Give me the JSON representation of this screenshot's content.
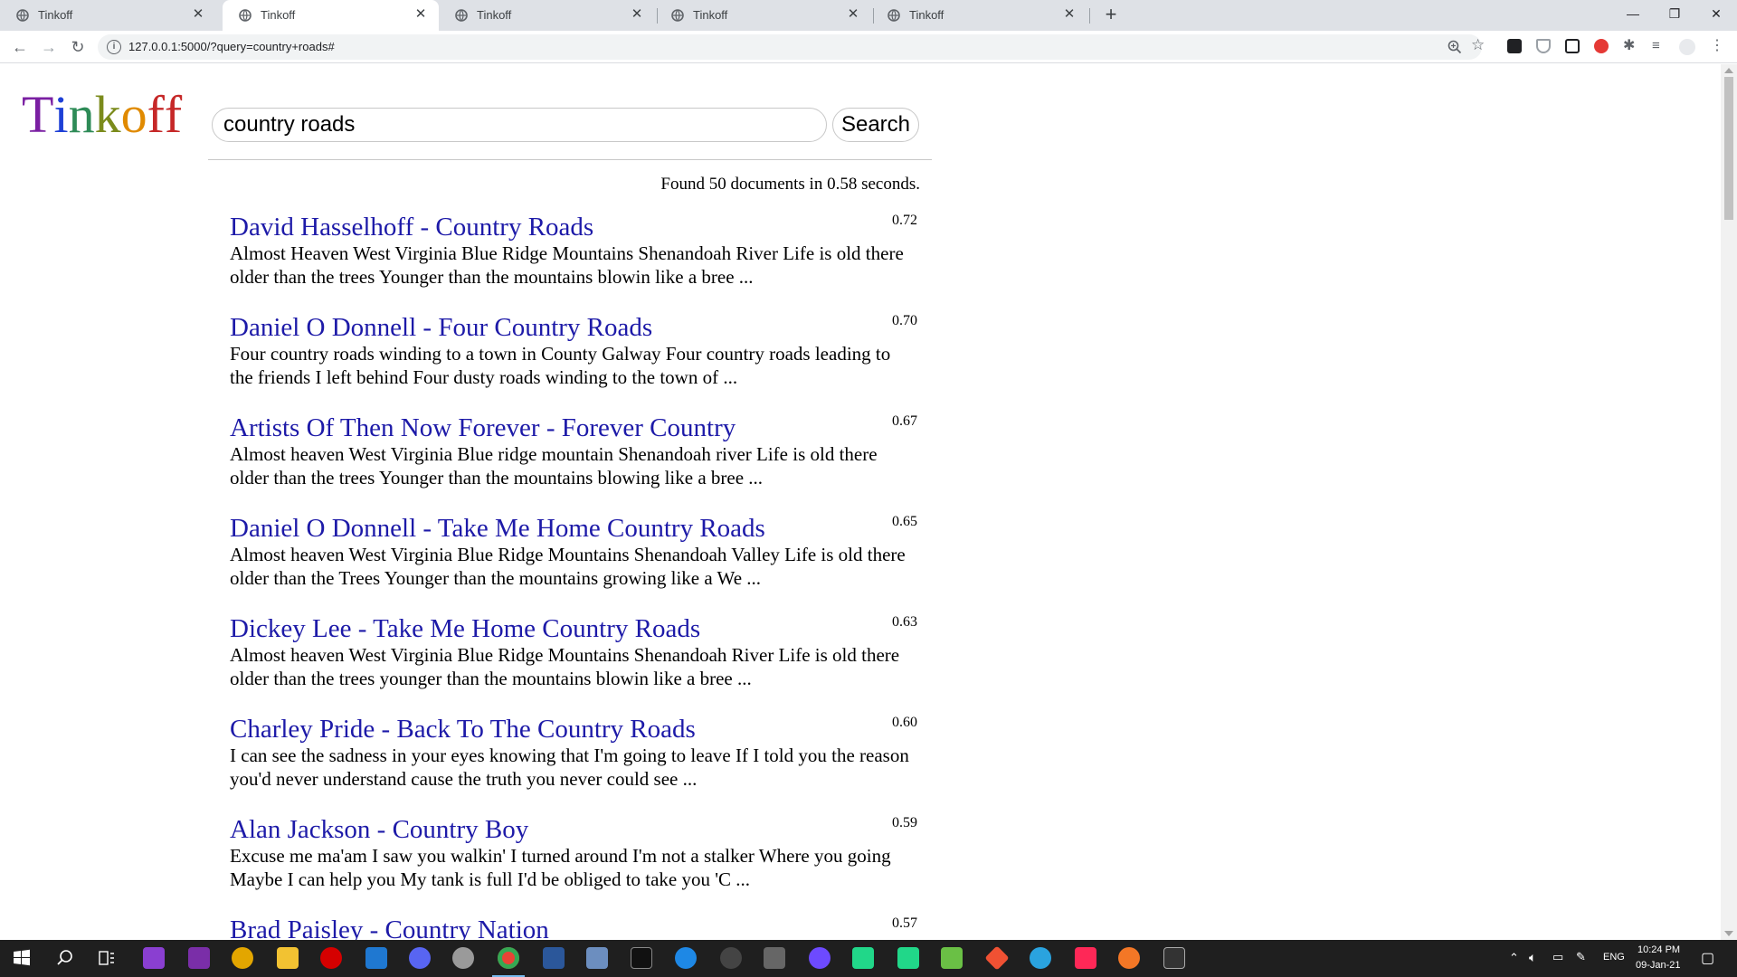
{
  "browser": {
    "tabs": [
      {
        "title": "Tinkoff",
        "active": false
      },
      {
        "title": "Tinkoff",
        "active": true
      },
      {
        "title": "Tinkoff",
        "active": false
      },
      {
        "title": "Tinkoff",
        "active": false
      },
      {
        "title": "Tinkoff",
        "active": false
      }
    ],
    "url": "127.0.0.1:5000/?query=country+roads#"
  },
  "page": {
    "logo": [
      "T",
      "i",
      "n",
      "k",
      "o",
      "f",
      "f"
    ],
    "logo_colors": [
      "#7a1fa2",
      "#1e40d6",
      "#2e8b57",
      "#7b8b1c",
      "#e08a00",
      "#c62828",
      "#c62828"
    ],
    "search": {
      "value": "country roads",
      "button_label": "Search"
    },
    "stats": "Found 50 documents in 0.58 seconds.",
    "results": [
      {
        "title": "David Hasselhoff - Country Roads",
        "score": "0.72",
        "snippet": "Almost Heaven West Virginia Blue Ridge Mountains Shenandoah River Life is old there older than the trees Younger than the mountains blowin like a bree ..."
      },
      {
        "title": "Daniel O Donnell - Four Country Roads",
        "score": "0.70",
        "snippet": "Four country roads winding to a town in County Galway Four country roads leading to the friends I left behind Four dusty roads winding to the town of ..."
      },
      {
        "title": "Artists Of Then Now Forever - Forever Country",
        "score": "0.67",
        "snippet": "Almost heaven West Virginia Blue ridge mountain Shenandoah river Life is old there older than the trees Younger than the mountains blowing like a bree ..."
      },
      {
        "title": "Daniel O Donnell - Take Me Home Country Roads",
        "score": "0.65",
        "snippet": "Almost heaven West Virginia Blue Ridge Mountains Shenandoah Valley Life is old there older than the Trees Younger than the mountains growing like a We ..."
      },
      {
        "title": "Dickey Lee - Take Me Home Country Roads",
        "score": "0.63",
        "snippet": "Almost heaven West Virginia Blue Ridge Mountains Shenandoah River Life is old there older than the trees younger than the mountains blowin like a bree ..."
      },
      {
        "title": "Charley Pride - Back To The Country Roads",
        "score": "0.60",
        "snippet": "I can see the sadness in your eyes knowing that I'm going to leave If I told you the reason you'd never understand cause the truth you never could see ..."
      },
      {
        "title": "Alan Jackson - Country Boy",
        "score": "0.59",
        "snippet": "Excuse me ma'am I saw you walkin' I turned around I'm not a stalker Where you going Maybe I can help you My tank is full I'd be obliged to take you 'C ..."
      },
      {
        "title": "Brad Paisley - Country Nation",
        "score": "0.57",
        "snippet": ""
      }
    ]
  },
  "taskbar": {
    "lang": "ENG",
    "time": "10:24 PM",
    "date": "09-Jan-21"
  }
}
